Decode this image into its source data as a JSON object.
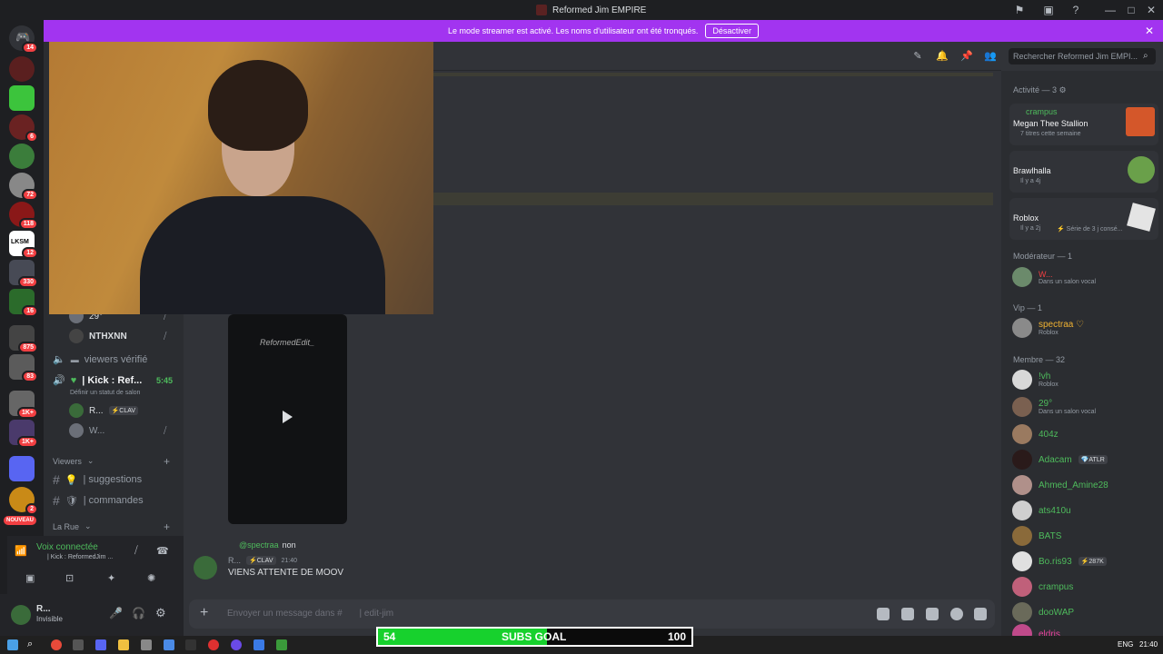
{
  "window": {
    "title": "Reformed Jim EMPIRE",
    "minimize": "—",
    "maximize": "□",
    "close": "✕"
  },
  "banner": {
    "text": "Le mode streamer est activé. Les noms d'utilisateur ont été tronqués.",
    "button": "Désactiver",
    "close": "✕"
  },
  "servers": {
    "badges": [
      "14",
      "6",
      "72",
      "118",
      "12",
      "330",
      "16",
      "875",
      "83",
      "1K+",
      "1K+",
      "2"
    ],
    "new_label": "NOUVEAU",
    "lksm": "LKSM"
  },
  "channels": {
    "voice_users": [
      {
        "name": "29°",
        "muted_icon": "mic-off-icon"
      },
      {
        "name": "NTHXNN",
        "muted_icon": "mic-off-icon"
      }
    ],
    "viewers_verified": "viewers vérifié",
    "kick_channel": "| Kick : Ref...",
    "kick_time": "5:45",
    "status_hint": "Définir un statut de salon",
    "kick_users": [
      {
        "name": "R...",
        "tag": "⚡CLAV"
      },
      {
        "name": "W..."
      }
    ],
    "category_viewers": "Viewers",
    "text_channels": [
      {
        "icon": "💡",
        "name": "| suggestions"
      },
      {
        "icon": "🛡",
        "name": "| commandes"
      }
    ],
    "category_rue": "La Rue",
    "add": "+"
  },
  "voice_panel": {
    "status": "Voix connectée",
    "channel": "| Kick : ReformedJim ..."
  },
  "user_panel": {
    "name": "R...",
    "status": "Invisible"
  },
  "chat": {
    "video_watermark": "ReformedEdit_",
    "reply_to": "@spectraa",
    "reply_text": "non",
    "author": "R...",
    "author_tag": "⚡CLAV",
    "time": "21:40",
    "text": "VIENS ATTENTE DE MOOV",
    "composer_placeholder": "Envoyer un message dans #",
    "composer_channel": "| edit-jim"
  },
  "search": {
    "placeholder": "Rechercher Reformed Jim EMPI..."
  },
  "activity": {
    "header": "Activité — 3",
    "items": [
      {
        "user": "crampus",
        "title": "Megan Thee Stallion",
        "sub": "7 titres cette semaine"
      },
      {
        "user": "",
        "title": "Brawlhalla",
        "sub": "Il y a 4j"
      },
      {
        "user": "",
        "title": "Roblox",
        "sub": "Il y a 2j",
        "extra": "⚡ Série de 3 j consé..."
      }
    ]
  },
  "members": {
    "moderator_header": "Modérateur — 1",
    "moderator": {
      "name": "W...",
      "sub": "Dans un salon vocal"
    },
    "vip_header": "Vip — 1",
    "vip": {
      "name": "spectraa ♡",
      "sub": "Roblox"
    },
    "member_header": "Membre — 32",
    "list": [
      {
        "name": "!vh",
        "sub": "Roblox",
        "color": "#4ebb5c"
      },
      {
        "name": "29° ",
        "sub": "Dans un salon vocal",
        "color": "#4ebb5c"
      },
      {
        "name": "404z",
        "sub": "",
        "color": "#4ebb5c"
      },
      {
        "name": "Adacam",
        "sub": "",
        "color": "#4ebb5c",
        "tag": "💎ATLR"
      },
      {
        "name": "Ahmed_Amine28",
        "sub": "",
        "color": "#4ebb5c"
      },
      {
        "name": "ats410u",
        "sub": "",
        "color": "#4ebb5c"
      },
      {
        "name": "BATS",
        "sub": "",
        "color": "#4ebb5c"
      },
      {
        "name": "Bo.ris93",
        "sub": "",
        "color": "#4ebb5c",
        "tag": "⚡287K"
      },
      {
        "name": "crampus",
        "sub": "",
        "color": "#4ebb5c"
      },
      {
        "name": "dooWAP",
        "sub": "",
        "color": "#4ebb5c"
      },
      {
        "name": "eldris",
        "sub": "",
        "color": "#eb459e"
      }
    ]
  },
  "subs_goal": {
    "current": "54",
    "label": "SUBS GOAL",
    "target": "100",
    "progress": 0.54
  },
  "taskbar": {
    "lang": "ENG",
    "time": "21:40"
  }
}
